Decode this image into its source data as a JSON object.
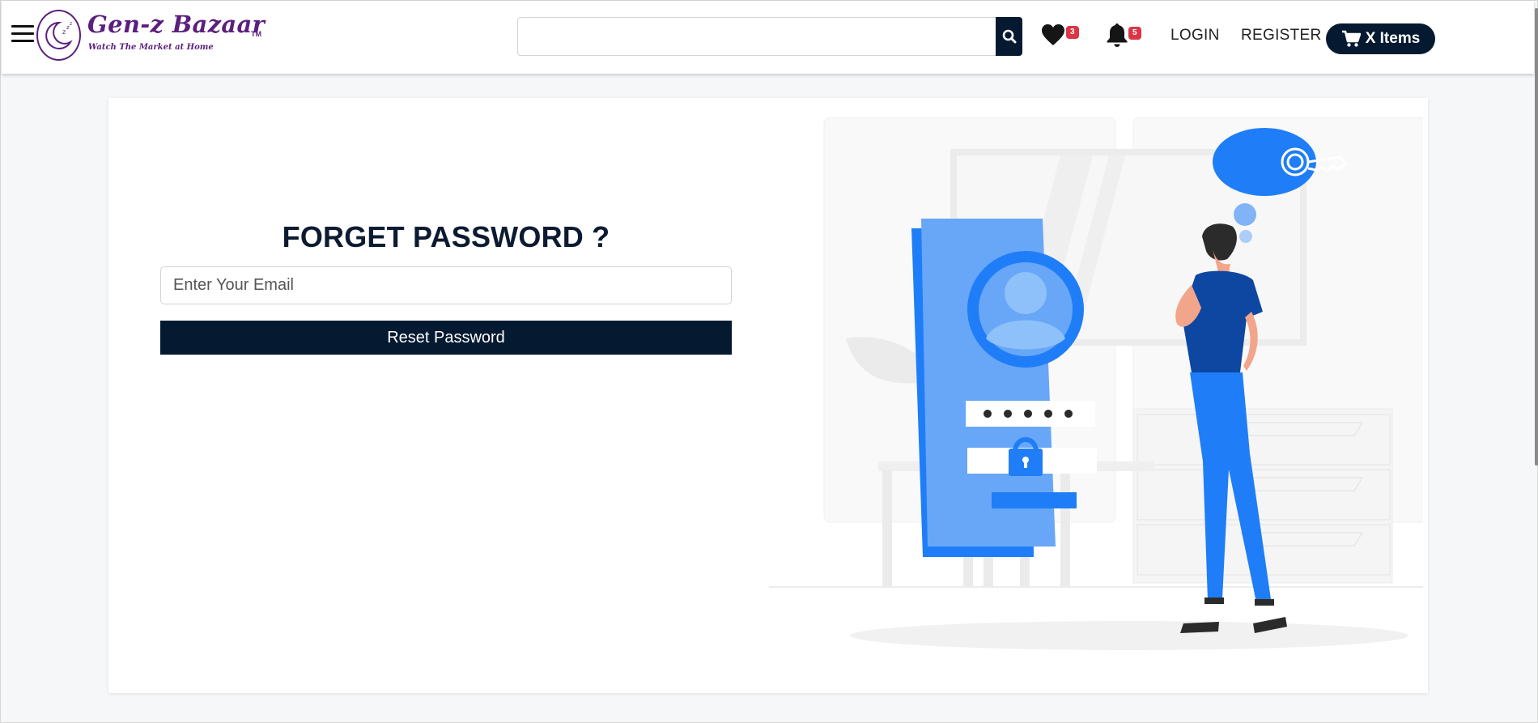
{
  "header": {
    "brand_name": "Gen-z Bazaar",
    "trademark": "TM",
    "tagline": "Watch The Market at Home",
    "search_placeholder": "",
    "wishlist_count": "3",
    "notification_count": "5",
    "login_label": "LOGIN",
    "register_label": "REGISTER",
    "cart_label": "X Items"
  },
  "form": {
    "title": "FORGET PASSWORD ?",
    "email_placeholder": "Enter Your Email",
    "email_value": "",
    "submit_label": "Reset Password"
  },
  "icons": [
    "menu-icon",
    "moon-sleep-icon",
    "search-icon",
    "heart-icon",
    "bell-icon",
    "cart-icon",
    "key-icon",
    "lock-icon",
    "user-icon"
  ],
  "colors": {
    "navy": "#051a31",
    "brand_purple": "#5b1f7e",
    "badge_red": "#dc3545",
    "illustration_blue": "#1f7ef7"
  }
}
